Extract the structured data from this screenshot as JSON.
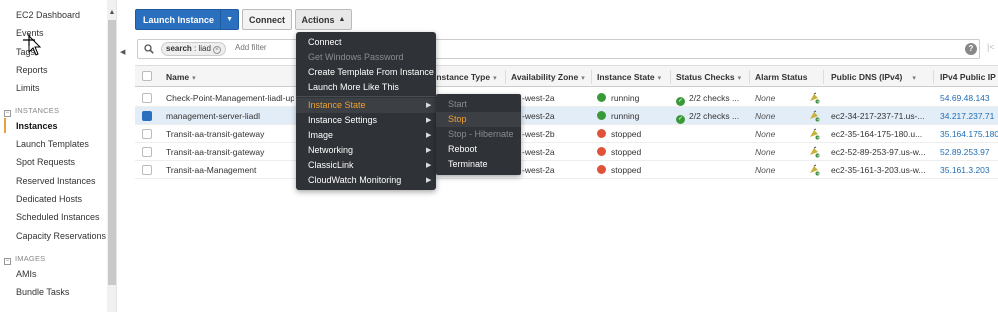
{
  "sidebar": {
    "items_top": [
      {
        "label": "EC2 Dashboard"
      },
      {
        "label": "Events"
      },
      {
        "label": "Tags"
      },
      {
        "label": "Reports"
      },
      {
        "label": "Limits"
      }
    ],
    "section_instances": "INSTANCES",
    "instances_items": [
      {
        "label": "Instances",
        "active": true
      },
      {
        "label": "Launch Templates"
      },
      {
        "label": "Spot Requests"
      },
      {
        "label": "Reserved Instances"
      },
      {
        "label": "Dedicated Hosts"
      },
      {
        "label": "Scheduled Instances"
      },
      {
        "label": "Capacity Reservations"
      }
    ],
    "section_images": "IMAGES",
    "images_items": [
      {
        "label": "AMIs"
      },
      {
        "label": "Bundle Tasks"
      }
    ],
    "section_toggle": "−"
  },
  "toolbar": {
    "launch_label": "Launch Instance",
    "connect_label": "Connect",
    "actions_label": "Actions"
  },
  "search": {
    "chip_key": "search",
    "chip_value": ": liad",
    "placeholder": "Add filter"
  },
  "table": {
    "columns": [
      {
        "label": "Name"
      },
      {
        "label": "Instance Type"
      },
      {
        "label": "Availability Zone"
      },
      {
        "label": "Instance State"
      },
      {
        "label": "Status Checks"
      },
      {
        "label": "Alarm Status"
      },
      {
        "label": "Public DNS (IPv4)"
      },
      {
        "label": "IPv4 Public IP"
      }
    ],
    "rows": [
      {
        "name": "Check-Point-Management-liadl-up",
        "az": "-west-2a",
        "state": "running",
        "state_color": "#3a9a3a",
        "checks": "2/2 checks ...",
        "alarm": "None",
        "dns": "",
        "ip": "54.69.48.143",
        "selected": false
      },
      {
        "name": "management-server-liadl",
        "az": "-west-2a",
        "state": "running",
        "state_color": "#3a9a3a",
        "checks": "2/2 checks ...",
        "alarm": "None",
        "dns": "ec2-34-217-237-71.us-...",
        "ip": "34.217.237.71",
        "selected": true
      },
      {
        "name": "Transit-aa-transit-gateway",
        "az": "-west-2b",
        "state": "stopped",
        "state_color": "#e0523a",
        "checks": "",
        "alarm": "None",
        "dns": "ec2-35-164-175-180.u...",
        "ip": "35.164.175.180",
        "selected": false
      },
      {
        "name": "Transit-aa-transit-gateway",
        "az": "-west-2a",
        "state": "stopped",
        "state_color": "#e0523a",
        "checks": "",
        "alarm": "None",
        "dns": "ec2-52-89-253-97.us-w...",
        "ip": "52.89.253.97",
        "selected": false
      },
      {
        "name": "Transit-aa-Management",
        "az": "-west-2a",
        "state": "stopped",
        "state_color": "#e0523a",
        "checks": "",
        "alarm": "None",
        "dns": "ec2-35-161-3-203.us-w...",
        "ip": "35.161.3.203",
        "selected": false
      }
    ]
  },
  "actions_menu": {
    "items": [
      {
        "label": "Connect",
        "disabled": false
      },
      {
        "label": "Get Windows Password",
        "disabled": true
      },
      {
        "label": "Create Template From Instance",
        "disabled": false
      },
      {
        "label": "Launch More Like This",
        "disabled": false
      },
      {
        "label": "Instance State",
        "submenu": true,
        "highlight": true
      },
      {
        "label": "Instance Settings",
        "submenu": true
      },
      {
        "label": "Image",
        "submenu": true
      },
      {
        "label": "Networking",
        "submenu": true
      },
      {
        "label": "ClassicLink",
        "submenu": true
      },
      {
        "label": "CloudWatch Monitoring",
        "submenu": true
      }
    ]
  },
  "instance_state_menu": {
    "items": [
      {
        "label": "Start",
        "disabled": true
      },
      {
        "label": "Stop",
        "highlight": true
      },
      {
        "label": "Stop - Hibernate",
        "disabled": true
      },
      {
        "label": "Reboot"
      },
      {
        "label": "Terminate"
      }
    ]
  },
  "colors": {
    "primary": "#2b6fbf",
    "running": "#3a9a3a",
    "stopped": "#e0523a",
    "menu_bg": "#2f3236",
    "menu_highlight": "#f0a030",
    "link": "#1f6db3"
  },
  "icons": {
    "search": "search-icon",
    "help": "help-icon",
    "alarm": "alarm-bell-icon"
  }
}
